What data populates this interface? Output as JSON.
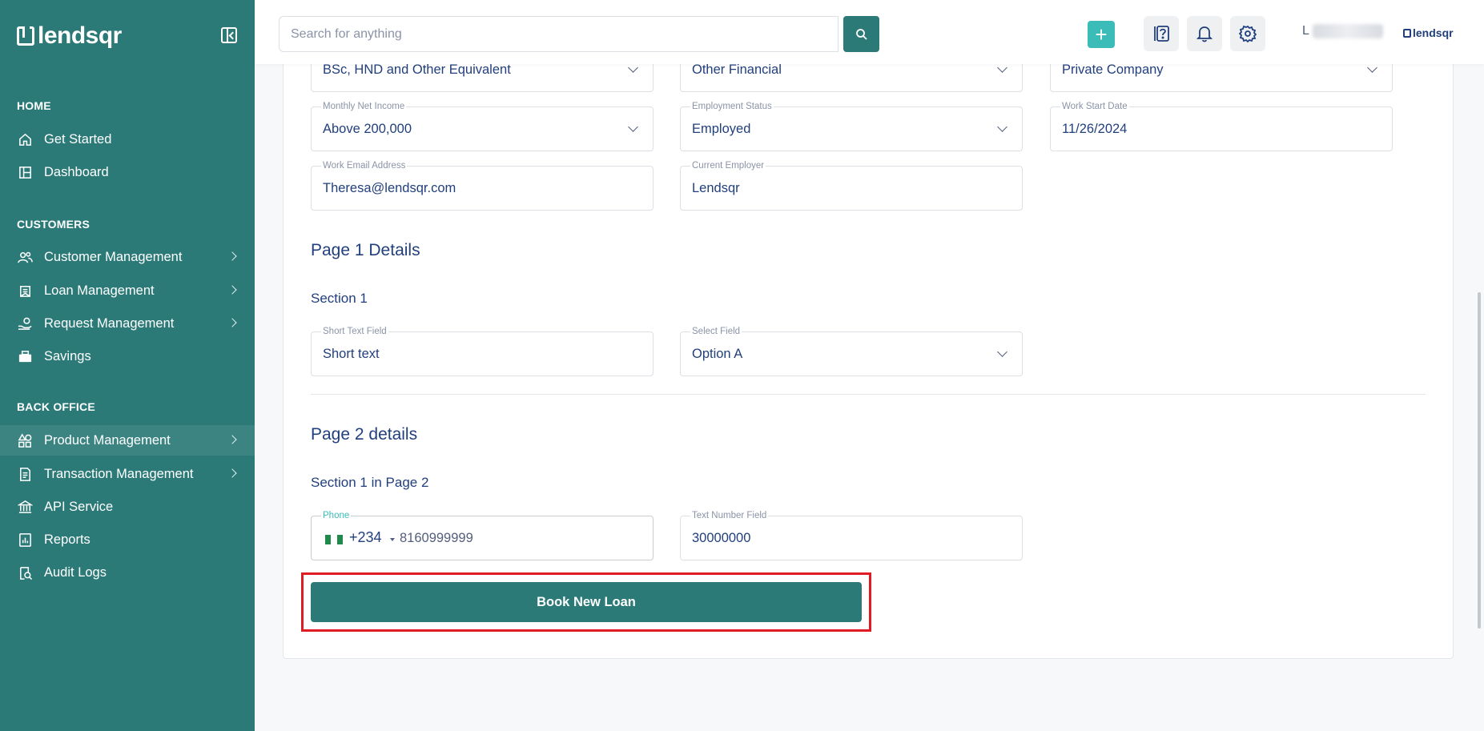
{
  "app": {
    "brand": "lendsqr",
    "small_brand": "lendsqr"
  },
  "search": {
    "placeholder": "Search for anything"
  },
  "topbar": {
    "add_label": "+",
    "user_initial": "L"
  },
  "sidebar": {
    "sections": [
      {
        "title": "HOME",
        "items": [
          {
            "label": "Get Started",
            "icon": "home-icon",
            "has_chevron": false
          },
          {
            "label": "Dashboard",
            "icon": "dashboard-icon",
            "has_chevron": false
          }
        ]
      },
      {
        "title": "CUSTOMERS",
        "items": [
          {
            "label": "Customer Management",
            "icon": "users-icon",
            "has_chevron": true
          },
          {
            "label": "Loan Management",
            "icon": "loan-icon",
            "has_chevron": true
          },
          {
            "label": "Request Management",
            "icon": "request-icon",
            "has_chevron": true
          },
          {
            "label": "Savings",
            "icon": "savings-icon",
            "has_chevron": false
          }
        ]
      },
      {
        "title": "BACK OFFICE",
        "items": [
          {
            "label": "Product Management",
            "icon": "product-icon",
            "has_chevron": true,
            "active": true
          },
          {
            "label": "Transaction Management",
            "icon": "transaction-icon",
            "has_chevron": true
          },
          {
            "label": "API Service",
            "icon": "bank-icon",
            "has_chevron": false
          },
          {
            "label": "Reports",
            "icon": "reports-icon",
            "has_chevron": false
          },
          {
            "label": "Audit Logs",
            "icon": "audit-icon",
            "has_chevron": false
          }
        ]
      }
    ]
  },
  "form": {
    "row0": [
      {
        "value": "BSc, HND and Other Equivalent",
        "dropdown": true
      },
      {
        "value": "Other Financial",
        "dropdown": true
      },
      {
        "value": "Private Company",
        "dropdown": true
      }
    ],
    "row1": [
      {
        "label": "Monthly Net Income",
        "value": "Above 200,000",
        "dropdown": true
      },
      {
        "label": "Employment Status",
        "value": "Employed",
        "dropdown": true
      },
      {
        "label": "Work Start Date",
        "value": "11/26/2024",
        "dropdown": false
      }
    ],
    "row2": [
      {
        "label": "Work Email Address",
        "value": "Theresa@lendsqr.com"
      },
      {
        "label": "Current Employer",
        "value": "Lendsqr"
      }
    ],
    "page1_title": "Page 1 Details",
    "page1_section": "Section 1",
    "page1_fields": [
      {
        "label": "Short Text Field",
        "value": "Short text",
        "dropdown": false
      },
      {
        "label": "Select Field",
        "value": "Option A",
        "dropdown": true
      }
    ],
    "page2_title": "Page 2 details",
    "page2_section": "Section 1 in Page 2",
    "phone": {
      "label": "Phone",
      "dial_code": "+234",
      "number": "8160999999"
    },
    "text_number": {
      "label": "Text Number Field",
      "value": "30000000"
    },
    "submit_label": "Book New Loan"
  }
}
